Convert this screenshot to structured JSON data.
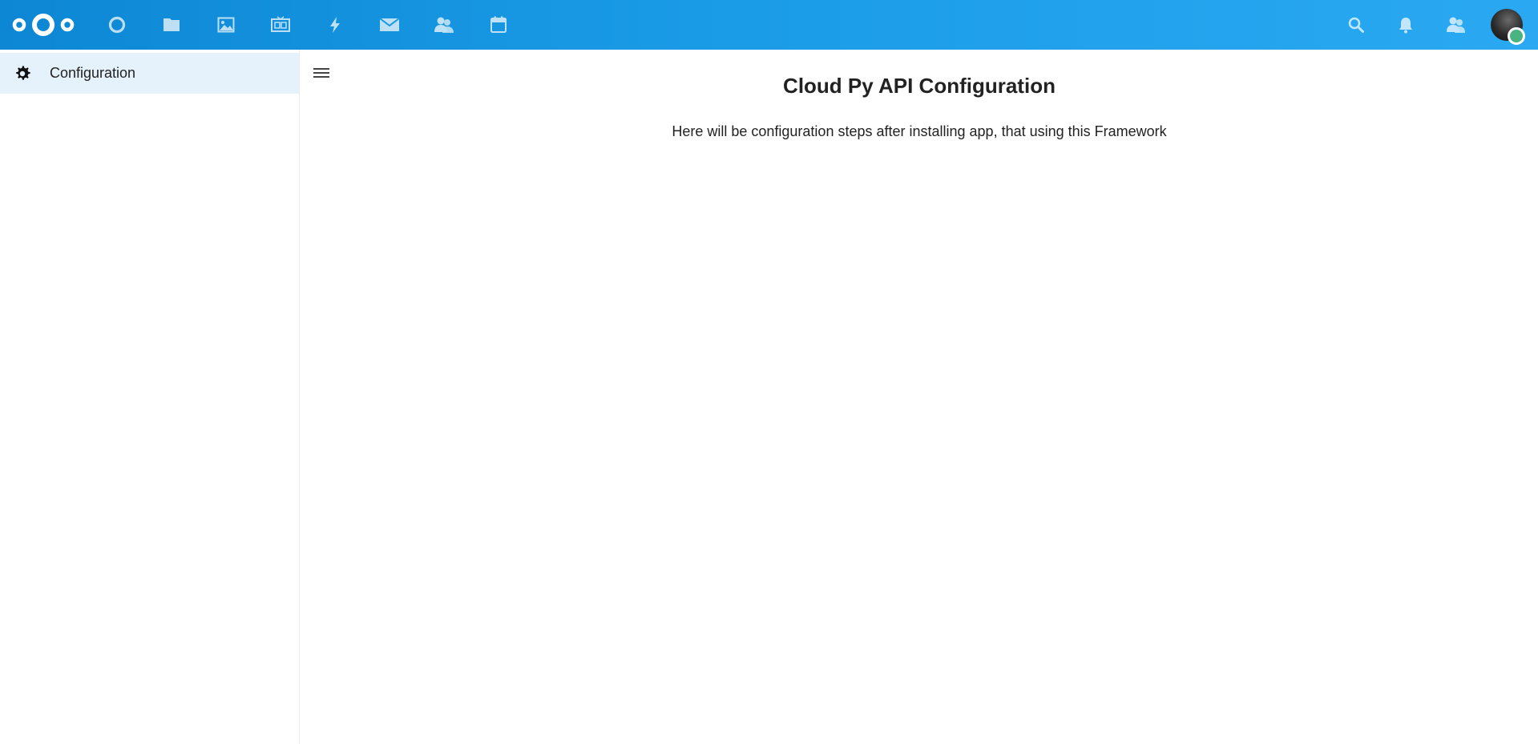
{
  "header": {
    "logo_icon": "nextcloud-logo",
    "apps": [
      {
        "icon": "dashboard-icon"
      },
      {
        "icon": "files-icon"
      },
      {
        "icon": "photos-icon"
      },
      {
        "icon": "talk-icon"
      },
      {
        "icon": "activity-icon"
      },
      {
        "icon": "mail-icon"
      },
      {
        "icon": "contacts-icon"
      },
      {
        "icon": "calendar-icon"
      }
    ],
    "right": [
      {
        "icon": "search-icon"
      },
      {
        "icon": "notifications-icon"
      },
      {
        "icon": "contacts-menu-icon"
      }
    ],
    "avatar_status_color": "#49b382"
  },
  "sidebar": {
    "items": [
      {
        "label": "Configuration",
        "icon": "gear-icon",
        "active": true
      }
    ]
  },
  "main": {
    "toggle_icon": "menu-icon",
    "title": "Cloud Py API Configuration",
    "description": "Here will be configuration steps after installing app, that using this Framework"
  },
  "colors": {
    "header_start": "#0d87d4",
    "header_end": "#2aa9f2",
    "active_item_bg": "#e5f2fb"
  }
}
